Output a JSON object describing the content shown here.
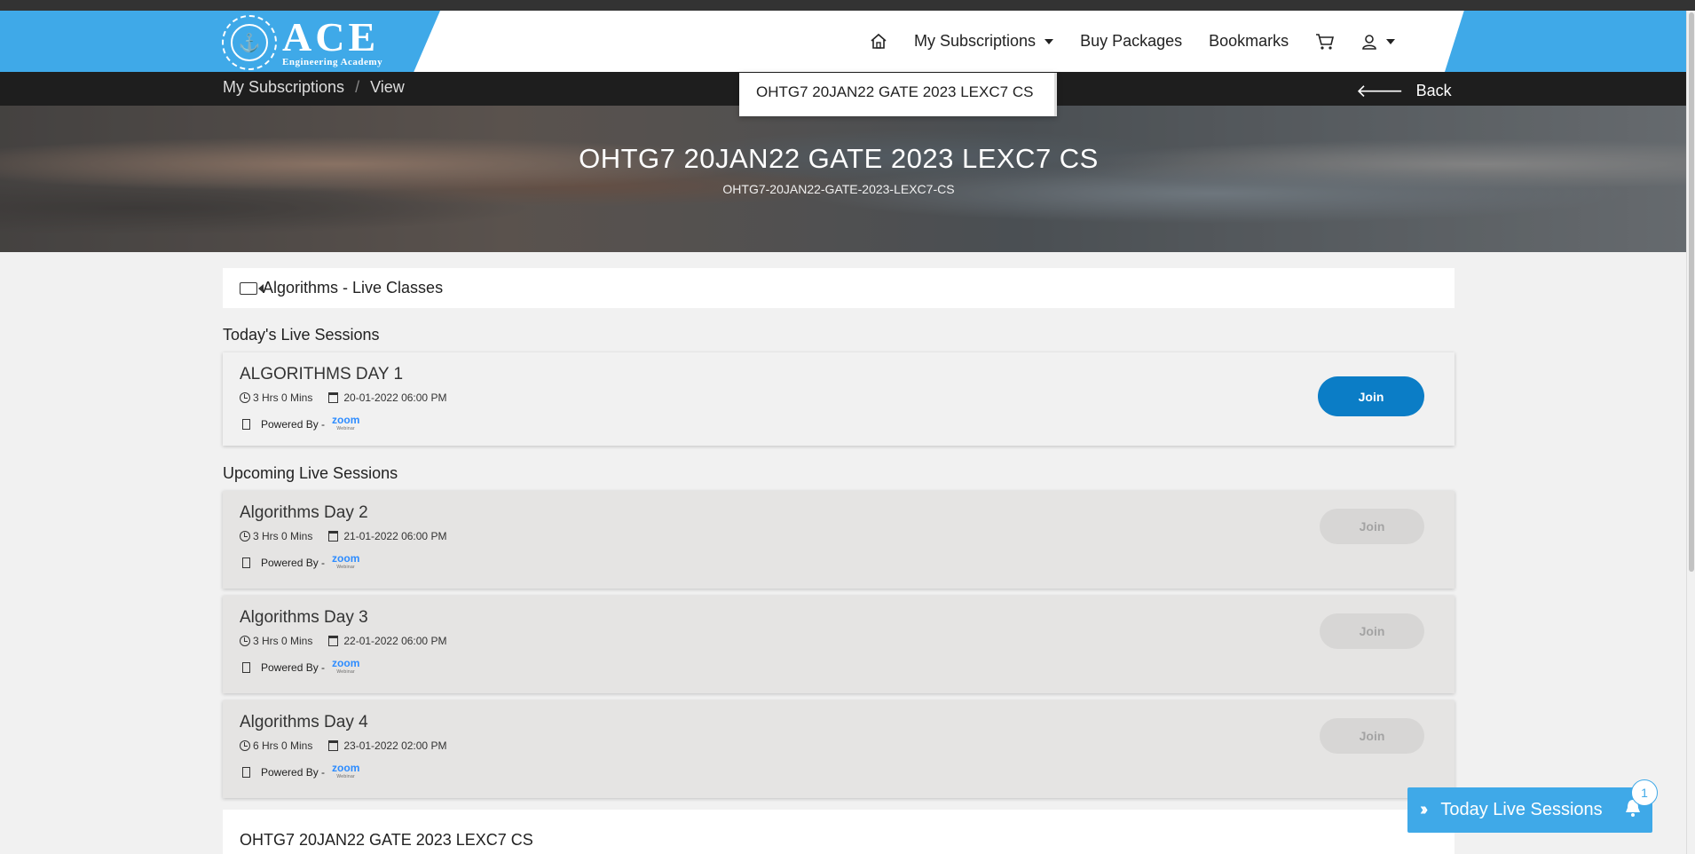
{
  "app": {
    "logo_main": "ACE",
    "logo_sub": "Engineering Academy"
  },
  "nav": {
    "home_icon": "home-icon",
    "my_subscriptions": "My Subscriptions",
    "buy_packages": "Buy Packages",
    "bookmarks": "Bookmarks",
    "cart_icon": "cart-icon",
    "user_icon": "user-icon"
  },
  "breadcrumb": {
    "items": [
      "My Subscriptions",
      "View"
    ],
    "separator": "/",
    "back_label": "Back"
  },
  "dropdown": {
    "item": "OHTG7 20JAN22 GATE 2023 LEXC7 CS"
  },
  "hero": {
    "title": "OHTG7 20JAN22 GATE 2023 LEXC7 CS",
    "subtitle": "OHTG7-20JAN22-GATE-2023-LEXC7-CS"
  },
  "section": {
    "title": "Algorithms - Live Classes"
  },
  "today": {
    "label": "Today's Live Sessions",
    "sessions": [
      {
        "name": "ALGORITHMS DAY 1",
        "duration": "3 Hrs 0 Mins",
        "datetime": "20-01-2022 06:00 PM",
        "powered": "Powered By -",
        "provider": "zoom",
        "provider_sub": "Webinar",
        "join": "Join"
      }
    ]
  },
  "upcoming": {
    "label": "Upcoming Live Sessions",
    "sessions": [
      {
        "name": "Algorithms Day 2",
        "duration": "3 Hrs 0 Mins",
        "datetime": "21-01-2022 06:00 PM",
        "powered": "Powered By -",
        "provider": "zoom",
        "provider_sub": "Webinar",
        "join": "Join"
      },
      {
        "name": "Algorithms Day 3",
        "duration": "3 Hrs 0 Mins",
        "datetime": "22-01-2022 06:00 PM",
        "powered": "Powered By -",
        "provider": "zoom",
        "provider_sub": "Webinar",
        "join": "Join"
      },
      {
        "name": "Algorithms Day 4",
        "duration": "6 Hrs 0 Mins",
        "datetime": "23-01-2022 02:00 PM",
        "powered": "Powered By -",
        "provider": "zoom",
        "provider_sub": "Webinar",
        "join": "Join"
      }
    ]
  },
  "bottom": {
    "title": "OHTG7 20JAN22 GATE 2023 LEXC7 CS"
  },
  "live_widget": {
    "label": "Today Live Sessions",
    "count": "1"
  },
  "colors": {
    "brand_blue": "#3fa9e8",
    "join_blue": "#0b7dc6",
    "dark_bar": "#1e1e1e"
  }
}
